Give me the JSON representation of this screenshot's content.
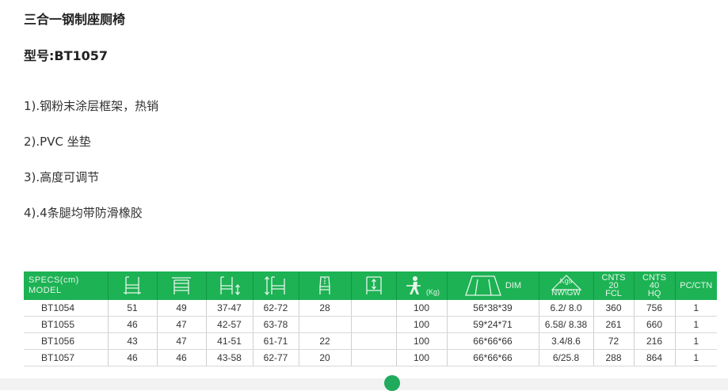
{
  "title": "三合一钢制座厕椅",
  "model_line": "型号:BT1057",
  "features": [
    "1).钢粉末涂层框架，热销",
    "2).PVC 坐垫",
    "3).高度可调节",
    "4).4条腿均带防滑橡胶"
  ],
  "spec_table": {
    "header": {
      "specs_line1": "SPECS(cm)",
      "specs_line2": "MODEL",
      "kg_unit": "(Kg)",
      "dim": "DIM",
      "nwgw_kgs": "Kgs",
      "nwgw": "NW\\GW",
      "cnts20_line1": "CNTS",
      "cnts20_line2": "20",
      "cnts20_line3": "FCL",
      "cnts40_line1": "CNTS",
      "cnts40_line2": "40",
      "cnts40_line3": "HQ",
      "pcctn": "PC/CTN"
    },
    "header_icons": [
      "chair-width-icon",
      "chair-depth-icon",
      "seat-height-icon",
      "overall-height-icon",
      "backrest-height-icon",
      "armrest-height-icon",
      "max-weight-icon",
      "dimension-box-icon",
      "weight-triangle-icon"
    ],
    "rows": [
      {
        "model": "BT1054",
        "c1": "51",
        "c2": "49",
        "c3": "37-47",
        "c4": "62-72",
        "c5": "28",
        "c6": "",
        "c7": "100",
        "dim": "56*38*39",
        "nwgw": "6.2/ 8.0",
        "fcl": "360",
        "hq": "756",
        "pc": "1"
      },
      {
        "model": "BT1055",
        "c1": "46",
        "c2": "47",
        "c3": "42-57",
        "c4": "63-78",
        "c5": "",
        "c6": "",
        "c7": "100",
        "dim": "59*24*71",
        "nwgw": "6.58/ 8.38",
        "fcl": "261",
        "hq": "660",
        "pc": "1"
      },
      {
        "model": "BT1056",
        "c1": "43",
        "c2": "47",
        "c3": "41-51",
        "c4": "61-71",
        "c5": "22",
        "c6": "",
        "c7": "100",
        "dim": "66*66*66",
        "nwgw": "3.4/8.6",
        "fcl": "72",
        "hq": "216",
        "pc": "1"
      },
      {
        "model": "BT1057",
        "c1": "46",
        "c2": "46",
        "c3": "43-58",
        "c4": "62-77",
        "c5": "20",
        "c6": "",
        "c7": "100",
        "dim": "66*66*66",
        "nwgw": "6/25.8",
        "fcl": "288",
        "hq": "864",
        "pc": "1"
      }
    ]
  },
  "colors": {
    "header_green": "#1db254",
    "header_text": "#e7f6ea",
    "accent_dot": "#1faa5c"
  }
}
